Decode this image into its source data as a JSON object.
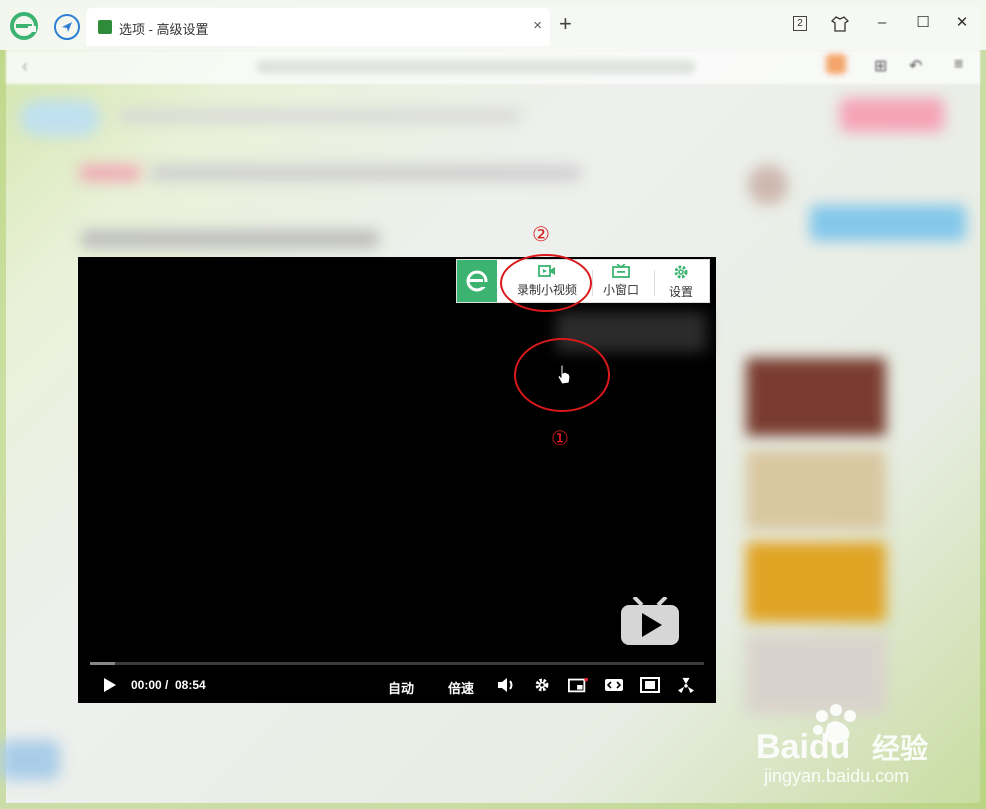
{
  "browser": {
    "tab_title": "选项 - 高级设置",
    "tab_close": "×",
    "new_tab": "+",
    "tab_count": "2",
    "skin_icon": "shirt-icon",
    "window_controls": [
      "–",
      "☐",
      "✕"
    ]
  },
  "player": {
    "time_current": "00:00",
    "time_separator": "/",
    "time_total": "08:54",
    "quality_label": "自动",
    "speed_label": "倍速",
    "progress_fraction": 0.04
  },
  "overlay_toolbar": {
    "record_label": "录制小视频",
    "mini_window_label": "小窗口",
    "settings_label": "设置"
  },
  "annotations": {
    "marker_1": "①",
    "marker_2": "②"
  },
  "watermark": {
    "brand": "Baidu",
    "brand_cn": "经验",
    "url": "jingyan.baidu.com"
  },
  "colors": {
    "accent_green": "#3cb371",
    "annotation_red": "#d9191b",
    "nav_blue": "#2d7fd3"
  }
}
